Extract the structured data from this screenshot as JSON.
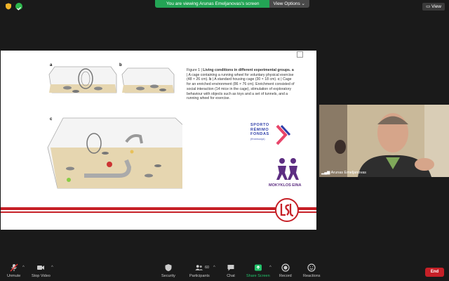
{
  "top": {
    "viewing_text": "You are viewing Arunas Emeljanovas's screen",
    "view_options": "View Options ⌄",
    "view_button": "View"
  },
  "slide": {
    "labels": {
      "a": "a",
      "b": "b",
      "c": "c"
    },
    "caption_lead": "Figure 1 | ",
    "caption_title": "Living conditions in different experimental groups.",
    "caption_body_parts": [
      {
        "bold": "a",
        "text": " | A cage containing a running wheel for voluntary physical exercise (48 × 26 cm). "
      },
      {
        "bold": "b",
        "text": " | A standard housing cage (30 × 18 cm). "
      },
      {
        "bold": "c",
        "text": " | Cage for an enriched environment (86 × 76 cm). Enrichment consisted of social interaction (14 mice in the cage), stimulation of exploratory behaviour with objects such as toys and a set of tunnels, and a running wheel for exercise."
      }
    ],
    "sporto": [
      "SPORTO",
      "RĖMIMO",
      "FONDAS"
    ],
    "sporto_sub": "(finansuoja)",
    "mokyklos": "MOKYKLOS EINA",
    "colors": {
      "accent_red": "#c62027",
      "sporto_blue": "#2d3da8",
      "mokyklos_purple": "#5d2e82"
    }
  },
  "webcam": {
    "name": "Arunas Emeljanovas"
  },
  "toolbar": {
    "unmute": "Unmute",
    "stop_video": "Stop Video",
    "security": "Security",
    "participants": "Participants",
    "participants_count": "60",
    "chat": "Chat",
    "share_screen": "Share Screen",
    "record": "Record",
    "reactions": "Reactions",
    "end": "End"
  }
}
